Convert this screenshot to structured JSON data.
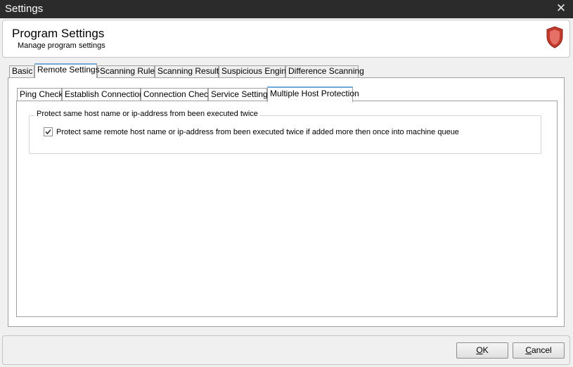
{
  "window": {
    "title": "Settings"
  },
  "header": {
    "title": "Program Settings",
    "subtitle": "Manage program settings",
    "icon": "shield-icon"
  },
  "tabs": [
    {
      "label": "Basic",
      "active": false
    },
    {
      "label": "Remote Settings",
      "active": true
    },
    {
      "label": "Scanning Rules",
      "active": false
    },
    {
      "label": "Scanning Results",
      "active": false
    },
    {
      "label": "Suspicious Engine",
      "active": false
    },
    {
      "label": "Difference Scanning",
      "active": false
    }
  ],
  "subtabs": [
    {
      "label": "Ping Check",
      "active": false
    },
    {
      "label": "Establish Connections",
      "active": false
    },
    {
      "label": "Connection Check",
      "active": false
    },
    {
      "label": "Service Settings",
      "active": false
    },
    {
      "label": "Multiple Host Protection",
      "active": true
    }
  ],
  "group": {
    "legend": "Protect same host name or ip-address from been executed twice",
    "checkbox_label": "Protect same remote host name or ip-address from been executed twice if added more then once into machine queue",
    "checked": true
  },
  "buttons": {
    "ok_mnemonic": "O",
    "ok_rest": "K",
    "cancel_mnemonic": "C",
    "cancel_rest": "ancel"
  },
  "colors": {
    "titlebar": "#2b2b2b",
    "active_tab_accent": "#6fa8dc",
    "shield": "#d9534f"
  }
}
